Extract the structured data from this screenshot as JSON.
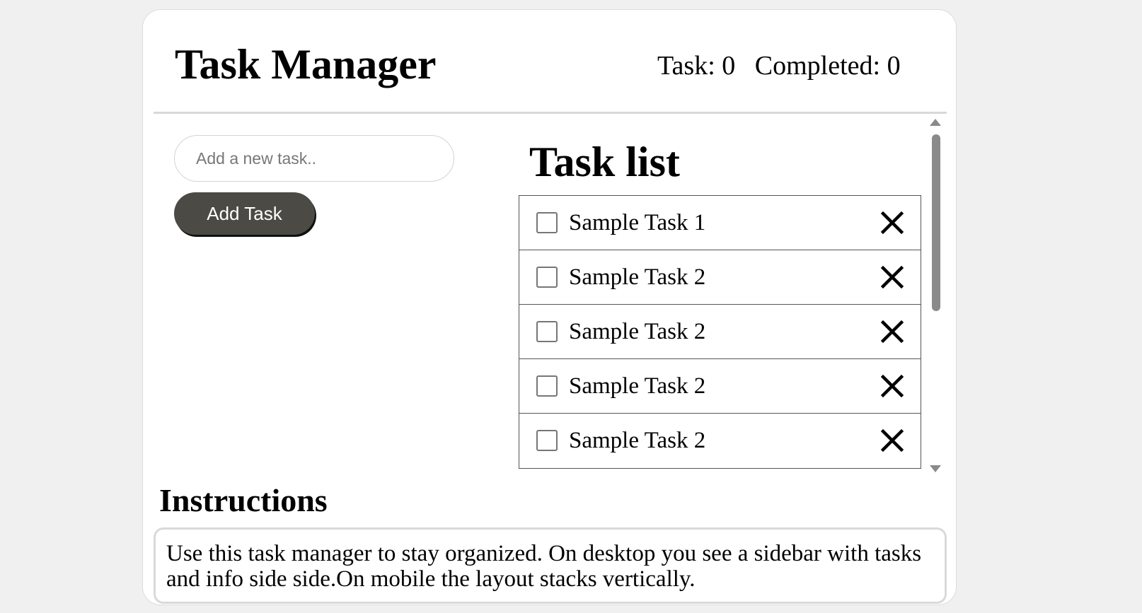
{
  "header": {
    "title": "Task Manager",
    "task_count_label": "Task: 0",
    "completed_count_label": "Completed: 0"
  },
  "form": {
    "input_placeholder": "Add a new task..",
    "input_value": "",
    "add_button_label": "Add Task"
  },
  "task_list": {
    "heading": "Task list",
    "items": [
      {
        "label": "Sample Task 1",
        "checked": false,
        "delete_icon": "close-icon"
      },
      {
        "label": "Sample Task 2",
        "checked": false,
        "delete_icon": "close-icon"
      },
      {
        "label": "Sample Task 2",
        "checked": false,
        "delete_icon": "close-icon"
      },
      {
        "label": "Sample Task 2",
        "checked": false,
        "delete_icon": "close-icon"
      },
      {
        "label": "Sample Task 2",
        "checked": false,
        "delete_icon": "close-icon"
      }
    ]
  },
  "instructions": {
    "heading": "Instructions",
    "text": "Use this task manager to stay organized. On desktop you see a sidebar with tasks and info side side.On mobile the layout stacks vertically."
  },
  "colors": {
    "page_background": "#f0f0f0",
    "card_background": "#ffffff",
    "button_background": "#4b4a45",
    "button_text": "#ffffff",
    "divider": "#d9d9d9"
  }
}
